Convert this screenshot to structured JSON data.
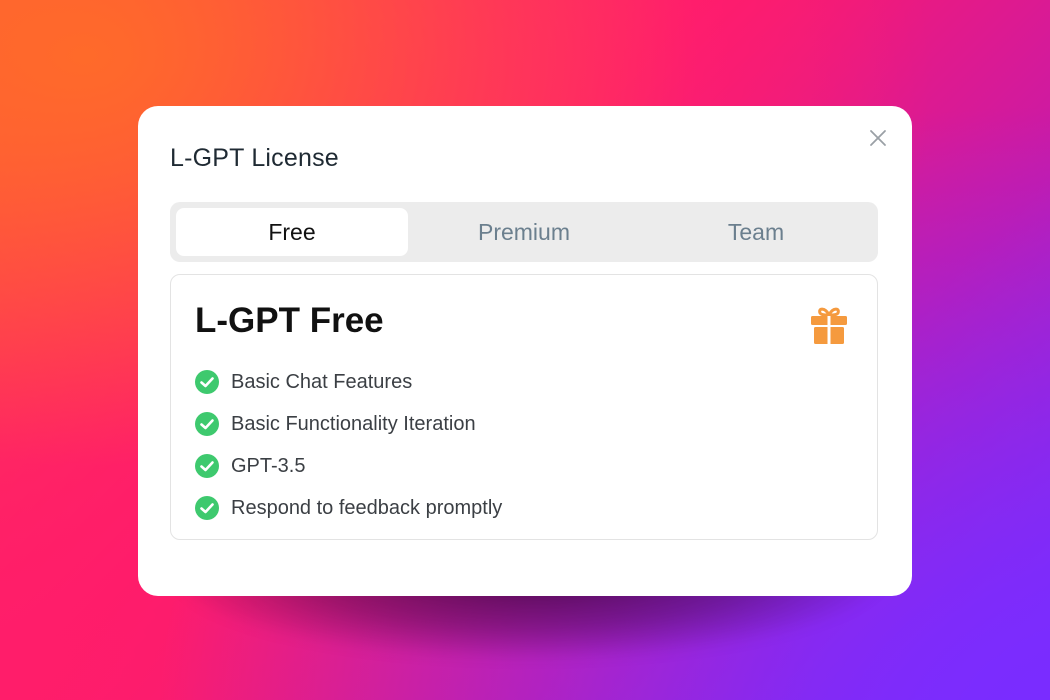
{
  "modal": {
    "title": "L-GPT License",
    "close_icon": "close-icon"
  },
  "tabs": [
    {
      "label": "Free",
      "active": true
    },
    {
      "label": "Premium",
      "active": false
    },
    {
      "label": "Team",
      "active": false
    }
  ],
  "plan": {
    "title": "L-GPT Free",
    "icon": "gift-icon",
    "features": [
      "Basic Chat Features",
      "Basic Functionality Iteration",
      "GPT-3.5",
      "Respond to feedback promptly"
    ]
  },
  "colors": {
    "check": "#3ec96e",
    "gift": "#f59a3e",
    "tab_inactive_text": "#6b7f8e"
  }
}
